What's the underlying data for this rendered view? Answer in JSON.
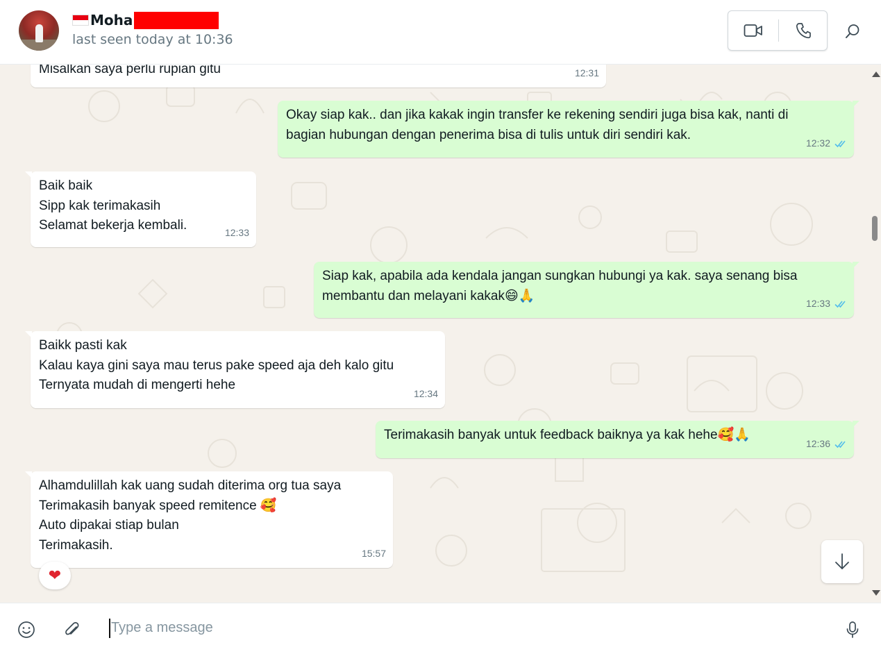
{
  "header": {
    "flag_icon": "indonesia-flag-icon",
    "name": "Mohan",
    "status": "last seen today at 10:36",
    "video_icon": "video-call-icon",
    "voice_icon": "phone-icon",
    "search_icon": "search-icon"
  },
  "messages": [
    {
      "dir": "in",
      "lines": [
        "Misalkan saya perlu rupian gitu"
      ],
      "time": "12:31"
    },
    {
      "dir": "out",
      "lines": [
        "Okay siap kak.. dan jika kakak ingin transfer ke rekening sendiri juga bisa kak, nanti di",
        "bagian hubungan dengan penerima bisa di tulis untuk diri sendiri kak."
      ],
      "time": "12:32",
      "status": "read"
    },
    {
      "dir": "in",
      "lines": [
        "Baik baik",
        "Sipp kak terimakasih",
        "Selamat bekerja kembali."
      ],
      "time": "12:33"
    },
    {
      "dir": "out",
      "lines": [
        "Siap kak, apabila ada kendala jangan sungkan hubungi ya kak. saya senang bisa",
        "membantu dan melayani kakak😄🙏"
      ],
      "time": "12:33",
      "status": "read"
    },
    {
      "dir": "in",
      "lines": [
        "Baikk pasti kak",
        "Kalau kaya gini saya mau terus pake speed aja deh kalo gitu",
        "Ternyata mudah di mengerti hehe"
      ],
      "time": "12:34"
    },
    {
      "dir": "out",
      "lines": [
        "Terimakasih banyak untuk feedback baiknya ya kak hehe🥰🙏"
      ],
      "time": "12:36",
      "status": "read"
    },
    {
      "dir": "in",
      "lines": [
        "Alhamdulillah kak uang sudah diterima org tua saya",
        "Terimakasih banyak speed remitence 🥰",
        "Auto dipakai stiap bulan",
        "Terimakasih."
      ],
      "time": "15:57",
      "reaction": "❤"
    }
  ],
  "composer": {
    "placeholder": "Type a message",
    "emoji_icon": "smiley-icon",
    "attach_icon": "paperclip-icon",
    "mic_icon": "microphone-icon"
  },
  "colors": {
    "outgoing_bubble": "#d9fdd3",
    "incoming_bubble": "#ffffff",
    "chat_background": "#f5f1eb",
    "read_tick": "#53bdeb",
    "timestamp": "#667781",
    "reaction_heart": "#e0242f"
  }
}
